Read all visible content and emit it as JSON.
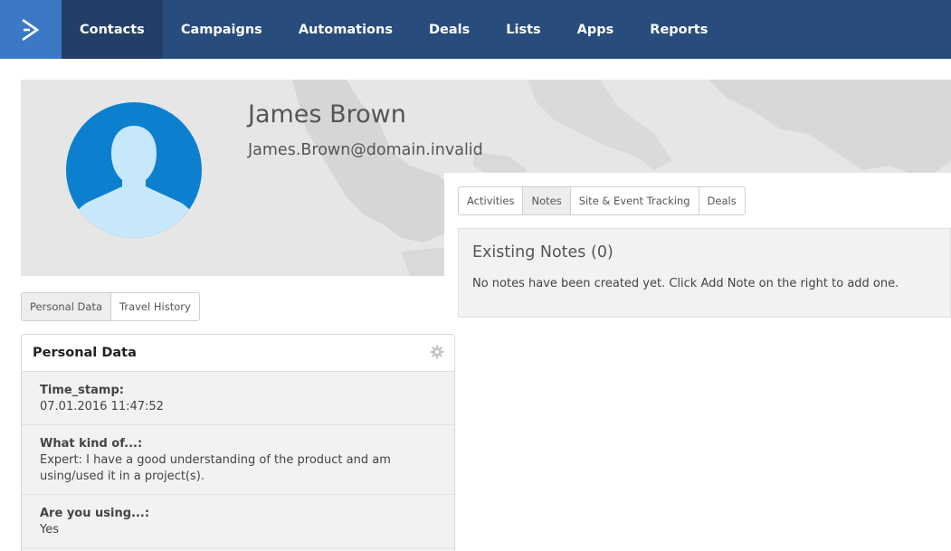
{
  "nav": {
    "items": [
      {
        "label": "Contacts",
        "active": true
      },
      {
        "label": "Campaigns",
        "active": false
      },
      {
        "label": "Automations",
        "active": false
      },
      {
        "label": "Deals",
        "active": false
      },
      {
        "label": "Lists",
        "active": false
      },
      {
        "label": "Apps",
        "active": false
      },
      {
        "label": "Reports",
        "active": false
      }
    ],
    "logo_icon": "chevron-right-logo-icon"
  },
  "contact": {
    "name": "James Brown",
    "email": "James.Brown@domain.invalid",
    "avatar_icon": "person-silhouette-icon"
  },
  "right_tabs": [
    {
      "label": "Activities",
      "active": false
    },
    {
      "label": "Notes",
      "active": true
    },
    {
      "label": "Site & Event Tracking",
      "active": false
    },
    {
      "label": "Deals",
      "active": false
    }
  ],
  "notes": {
    "title": "Existing Notes (0)",
    "empty_message": "No notes have been created yet. Click Add Note on the right to add one."
  },
  "left_tabs": [
    {
      "label": "Personal Data",
      "active": true
    },
    {
      "label": "Travel History",
      "active": false
    }
  ],
  "personal_data": {
    "title": "Personal Data",
    "settings_icon": "gear-icon",
    "fields": [
      {
        "label": "Time_stamp:",
        "value": "07.01.2016 11:47:52"
      },
      {
        "label": "What kind of...:",
        "value": "Expert: I have a good understanding of the product and am using/used it in a project(s)."
      },
      {
        "label": "Are you using...:",
        "value": "Yes"
      }
    ]
  },
  "colors": {
    "nav_bg": "#284c7c",
    "nav_active": "#233f68",
    "logo_bg": "#3b79c7",
    "avatar_bg": "#0d7fcf",
    "avatar_figure": "#c7e8fb"
  }
}
